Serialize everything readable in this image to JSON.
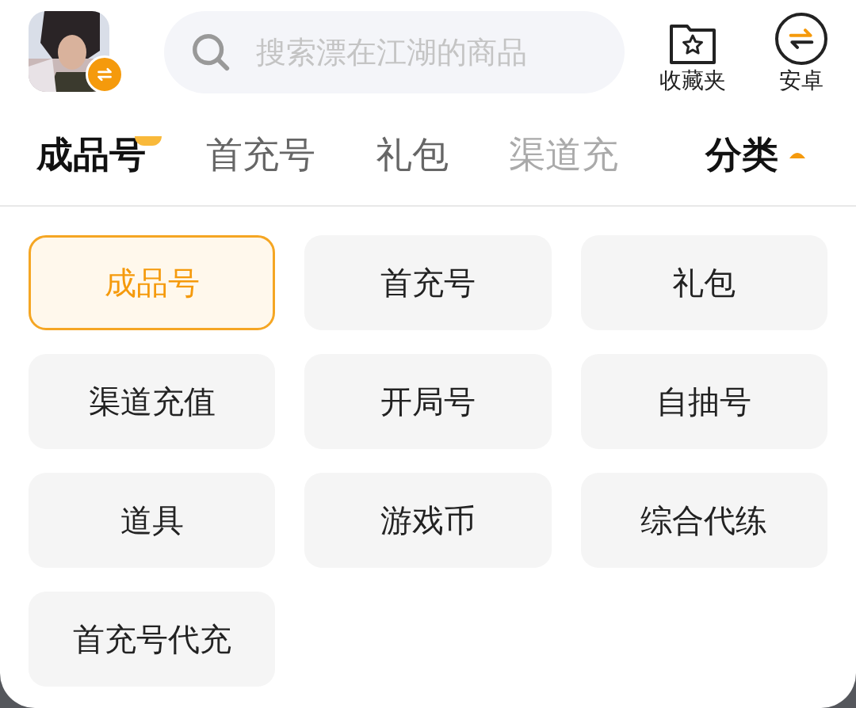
{
  "header": {
    "search": {
      "placeholder": "搜索漂在江湖的商品"
    },
    "actions": [
      {
        "kind": "favorites",
        "label": "收藏夹"
      },
      {
        "kind": "platform",
        "label": "安卓"
      }
    ]
  },
  "tabs": [
    {
      "label": "成品号",
      "selected": true
    },
    {
      "label": "首充号",
      "selected": false
    },
    {
      "label": "礼包",
      "selected": false
    },
    {
      "label": "渠道充",
      "selected": false
    }
  ],
  "category_toggle": {
    "label": "分类",
    "expanded": true
  },
  "categories": [
    {
      "label": "成品号",
      "selected": true
    },
    {
      "label": "首充号",
      "selected": false
    },
    {
      "label": "礼包",
      "selected": false
    },
    {
      "label": "渠道充值",
      "selected": false
    },
    {
      "label": "开局号",
      "selected": false
    },
    {
      "label": "自抽号",
      "selected": false
    },
    {
      "label": "道具",
      "selected": false
    },
    {
      "label": "游戏币",
      "selected": false
    },
    {
      "label": "综合代练",
      "selected": false
    },
    {
      "label": "首充号代充",
      "selected": false
    }
  ]
}
